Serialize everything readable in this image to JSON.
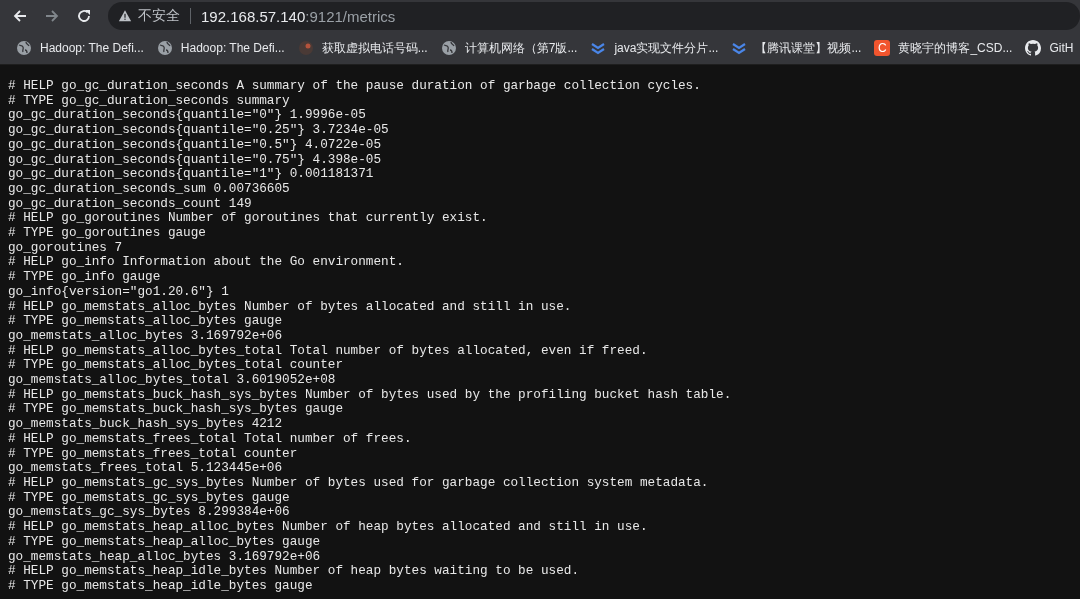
{
  "toolbar": {
    "security_label": "不安全",
    "url_host": "192.168.57.140",
    "url_rest": ":9121/metrics"
  },
  "bookmarks": [
    {
      "label": "Hadoop: The Defi...",
      "kind": "globe"
    },
    {
      "label": "Hadoop: The Defi...",
      "kind": "globe"
    },
    {
      "label": "获取虚拟电话号码...",
      "kind": "dark"
    },
    {
      "label": "计算机网络（第7版...",
      "kind": "globe"
    },
    {
      "label": "java实现文件分片...",
      "kind": "chevrons"
    },
    {
      "label": "【腾讯课堂】视频...",
      "kind": "chevrons"
    },
    {
      "label": "黄晓宇的博客_CSD...",
      "kind": "letter",
      "letter": "C"
    },
    {
      "label": "GitH",
      "kind": "github"
    }
  ],
  "lines": [
    "# HELP go_gc_duration_seconds A summary of the pause duration of garbage collection cycles.",
    "# TYPE go_gc_duration_seconds summary",
    "go_gc_duration_seconds{quantile=\"0\"} 1.9996e-05",
    "go_gc_duration_seconds{quantile=\"0.25\"} 3.7234e-05",
    "go_gc_duration_seconds{quantile=\"0.5\"} 4.0722e-05",
    "go_gc_duration_seconds{quantile=\"0.75\"} 4.398e-05",
    "go_gc_duration_seconds{quantile=\"1\"} 0.001181371",
    "go_gc_duration_seconds_sum 0.00736605",
    "go_gc_duration_seconds_count 149",
    "# HELP go_goroutines Number of goroutines that currently exist.",
    "# TYPE go_goroutines gauge",
    "go_goroutines 7",
    "# HELP go_info Information about the Go environment.",
    "# TYPE go_info gauge",
    "go_info{version=\"go1.20.6\"} 1",
    "# HELP go_memstats_alloc_bytes Number of bytes allocated and still in use.",
    "# TYPE go_memstats_alloc_bytes gauge",
    "go_memstats_alloc_bytes 3.169792e+06",
    "# HELP go_memstats_alloc_bytes_total Total number of bytes allocated, even if freed.",
    "# TYPE go_memstats_alloc_bytes_total counter",
    "go_memstats_alloc_bytes_total 3.6019052e+08",
    "# HELP go_memstats_buck_hash_sys_bytes Number of bytes used by the profiling bucket hash table.",
    "# TYPE go_memstats_buck_hash_sys_bytes gauge",
    "go_memstats_buck_hash_sys_bytes 4212",
    "# HELP go_memstats_frees_total Total number of frees.",
    "# TYPE go_memstats_frees_total counter",
    "go_memstats_frees_total 5.123445e+06",
    "# HELP go_memstats_gc_sys_bytes Number of bytes used for garbage collection system metadata.",
    "# TYPE go_memstats_gc_sys_bytes gauge",
    "go_memstats_gc_sys_bytes 8.299384e+06",
    "# HELP go_memstats_heap_alloc_bytes Number of heap bytes allocated and still in use.",
    "# TYPE go_memstats_heap_alloc_bytes gauge",
    "go_memstats_heap_alloc_bytes 3.169792e+06",
    "# HELP go_memstats_heap_idle_bytes Number of heap bytes waiting to be used.",
    "# TYPE go_memstats_heap_idle_bytes gauge"
  ]
}
